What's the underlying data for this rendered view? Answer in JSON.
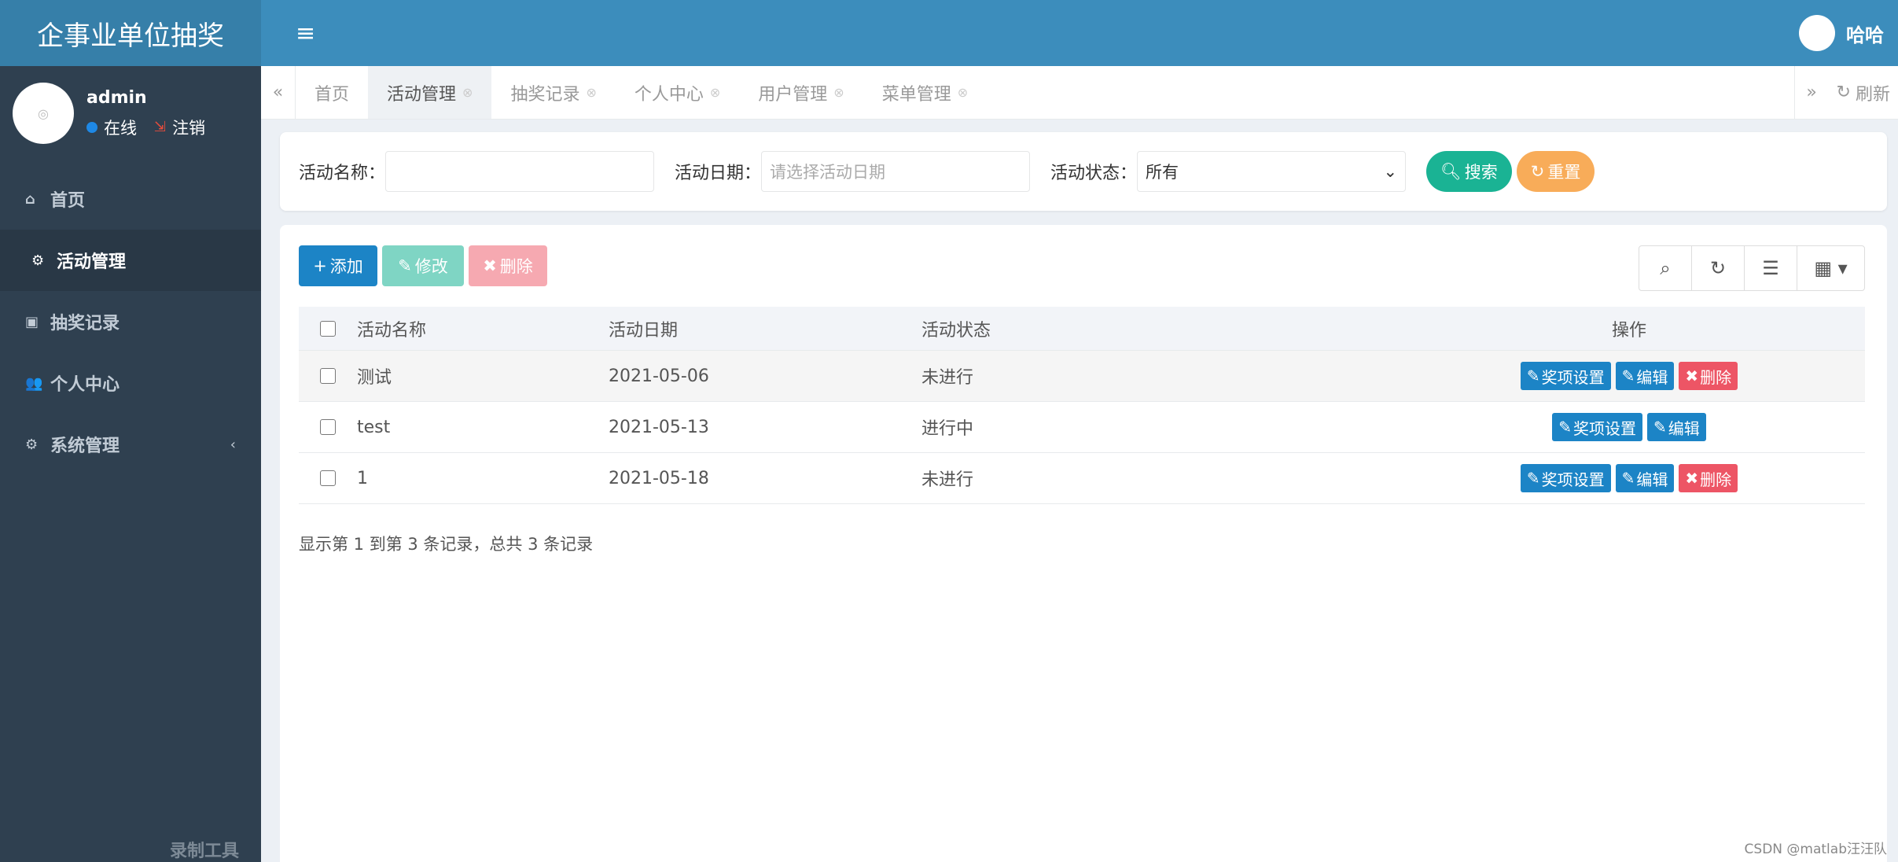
{
  "app": {
    "brand": "企事业单位抽奖",
    "sidebar_footer": "录制工具",
    "watermark": "CSDN @matlab汪汪队"
  },
  "user": {
    "name": "admin",
    "online": "在线",
    "logout": "注销",
    "header_name": "哈哈"
  },
  "sidebar": {
    "items": [
      {
        "label": "首页",
        "icon": "home-icon"
      },
      {
        "label": "活动管理",
        "icon": "cogs-icon"
      },
      {
        "label": "抽奖记录",
        "icon": "calendar-icon"
      },
      {
        "label": "个人中心",
        "icon": "users-icon"
      },
      {
        "label": "系统管理",
        "icon": "gear-icon"
      }
    ]
  },
  "tabs": {
    "items": [
      "首页",
      "活动管理",
      "抽奖记录",
      "个人中心",
      "用户管理",
      "菜单管理"
    ],
    "refresh": "刷新"
  },
  "search": {
    "name_label": "活动名称：",
    "name_value": "",
    "date_label": "活动日期：",
    "date_placeholder": "请选择活动日期",
    "status_label": "活动状态：",
    "status_value": "所有",
    "search_btn": "搜索",
    "reset_btn": "重置"
  },
  "toolbar": {
    "add": "添加",
    "edit": "修改",
    "delete": "删除"
  },
  "table": {
    "headers": [
      "活动名称",
      "活动日期",
      "活动状态",
      "操作"
    ],
    "rows": [
      {
        "name": "测试",
        "date": "2021-05-06",
        "status": "未进行",
        "ops": [
          "奖项设置",
          "编辑",
          "删除"
        ]
      },
      {
        "name": "test",
        "date": "2021-05-13",
        "status": "进行中",
        "ops": [
          "奖项设置",
          "编辑"
        ]
      },
      {
        "name": "1",
        "date": "2021-05-18",
        "status": "未进行",
        "ops": [
          "奖项设置",
          "编辑",
          "删除"
        ]
      }
    ],
    "pager": "显示第 1 到第 3 条记录，总共 3 条记录"
  },
  "colors": {
    "header": "#3c8dbc",
    "brand": "#367fa9",
    "sidebar": "#2f4050",
    "primary": "#1c84c6",
    "success": "#1ab394",
    "warning": "#f8ac59",
    "danger": "#ed5565"
  }
}
